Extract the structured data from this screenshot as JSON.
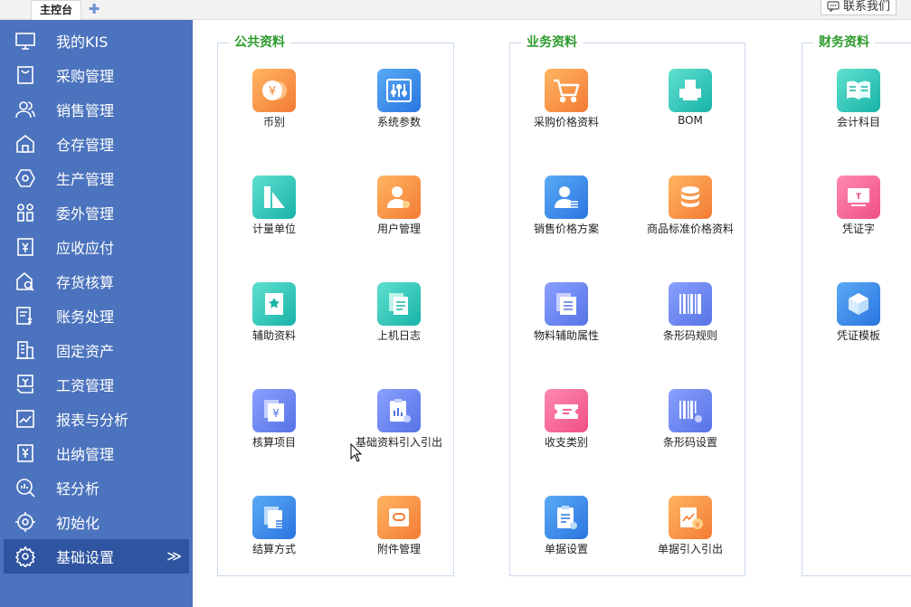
{
  "tabs": {
    "main": "主控台",
    "add": "✚"
  },
  "topbar": {
    "contact": "联系我们"
  },
  "sidebar": {
    "items": [
      {
        "label": "我的KIS",
        "icon": "monitor-icon"
      },
      {
        "label": "采购管理",
        "icon": "purchase-icon"
      },
      {
        "label": "销售管理",
        "icon": "users-icon"
      },
      {
        "label": "仓存管理",
        "icon": "warehouse-icon"
      },
      {
        "label": "生产管理",
        "icon": "production-icon"
      },
      {
        "label": "委外管理",
        "icon": "outsource-icon"
      },
      {
        "label": "应收应付",
        "icon": "receivable-icon"
      },
      {
        "label": "存货核算",
        "icon": "inventory-icon"
      },
      {
        "label": "账务处理",
        "icon": "accounting-icon"
      },
      {
        "label": "固定资产",
        "icon": "building-icon"
      },
      {
        "label": "工资管理",
        "icon": "salary-icon"
      },
      {
        "label": "报表与分析",
        "icon": "chart-icon"
      },
      {
        "label": "出纳管理",
        "icon": "cashier-icon"
      },
      {
        "label": "轻分析",
        "icon": "analysis-icon"
      },
      {
        "label": "初始化",
        "icon": "init-icon"
      },
      {
        "label": "基础设置",
        "icon": "gear-icon"
      }
    ],
    "expand": "≫"
  },
  "groups": {
    "public": {
      "title": "公共资料",
      "items": [
        "币别",
        "系统参数",
        "计量单位",
        "用户管理",
        "辅助资料",
        "上机日志",
        "核算项目",
        "基础资料引入引出",
        "结算方式",
        "附件管理"
      ]
    },
    "business": {
      "title": "业务资料",
      "items": [
        "采购价格资料",
        "BOM",
        "销售价格方案",
        "商品标准价格资料",
        "物料辅助属性",
        "条形码规则",
        "收支类别",
        "条形码设置",
        "单据设置",
        "单据引入引出"
      ]
    },
    "finance": {
      "title": "财务资料",
      "items": [
        "会计科目",
        "凭证字",
        "凭证模板"
      ]
    }
  },
  "colors": {
    "sidebar": "#4c73bd",
    "sidebar_active": "#2f55a0",
    "group_title": "#2e9b2e"
  }
}
